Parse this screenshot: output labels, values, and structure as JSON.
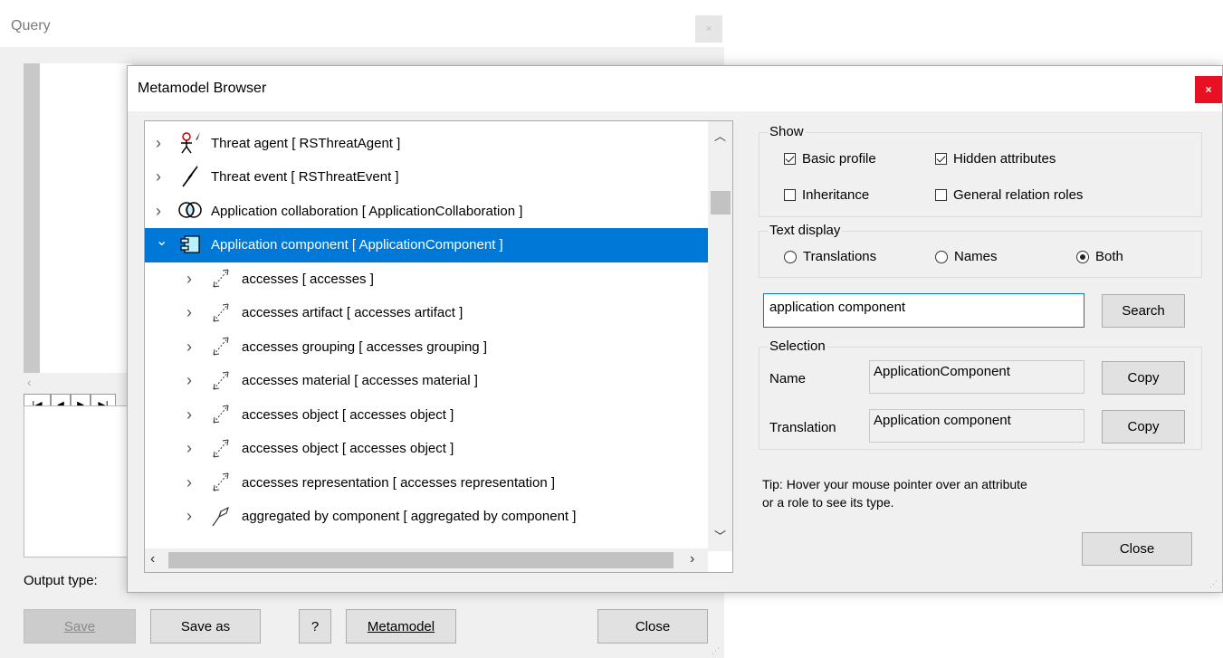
{
  "query_window": {
    "title": "Query",
    "output_type_label": "Output type:",
    "buttons": {
      "save": "Save",
      "save_as": "Save as",
      "help": "?",
      "metamodel": "Metamodel",
      "close": "Close"
    }
  },
  "browser": {
    "title": "Metamodel Browser",
    "close_glyph": "×",
    "tree": [
      {
        "label": "Threat agent [ RSThreatAgent ]",
        "icon": "threat-agent-icon",
        "level": 0,
        "expanded": false,
        "selected": false
      },
      {
        "label": "Threat event [ RSThreatEvent ]",
        "icon": "threat-event-icon",
        "level": 0,
        "expanded": false,
        "selected": false
      },
      {
        "label": "Application collaboration [ ApplicationCollaboration ]",
        "icon": "collaboration-icon",
        "level": 0,
        "expanded": false,
        "selected": false
      },
      {
        "label": "Application component [ ApplicationComponent ]",
        "icon": "component-icon",
        "level": 0,
        "expanded": true,
        "selected": true
      },
      {
        "label": "accesses [ accesses ]",
        "icon": "access-relation-icon",
        "level": 1,
        "expanded": false,
        "selected": false
      },
      {
        "label": "accesses artifact [ accesses artifact ]",
        "icon": "access-relation-icon",
        "level": 1,
        "expanded": false,
        "selected": false
      },
      {
        "label": "accesses grouping [ accesses grouping ]",
        "icon": "access-relation-icon",
        "level": 1,
        "expanded": false,
        "selected": false
      },
      {
        "label": "accesses material [ accesses material ]",
        "icon": "access-relation-icon",
        "level": 1,
        "expanded": false,
        "selected": false
      },
      {
        "label": "accesses object [ accesses object ]",
        "icon": "access-relation-icon",
        "level": 1,
        "expanded": false,
        "selected": false
      },
      {
        "label": "accesses object [ accesses object ]",
        "icon": "access-relation-icon",
        "level": 1,
        "expanded": false,
        "selected": false
      },
      {
        "label": "accesses representation [ accesses representation ]",
        "icon": "access-relation-icon",
        "level": 1,
        "expanded": false,
        "selected": false
      },
      {
        "label": "aggregated by component [ aggregated by component ]",
        "icon": "aggregation-relation-icon",
        "level": 1,
        "expanded": false,
        "selected": false
      }
    ],
    "show": {
      "label": "Show",
      "basic_profile": {
        "label": "Basic profile",
        "checked": true
      },
      "hidden_attributes": {
        "label": "Hidden attributes",
        "checked": true
      },
      "inheritance": {
        "label": "Inheritance",
        "checked": false
      },
      "general_relation_roles": {
        "label": "General relation roles",
        "checked": false
      }
    },
    "text_display": {
      "label": "Text display",
      "options": [
        {
          "label": "Translations",
          "selected": false
        },
        {
          "label": "Names",
          "selected": false
        },
        {
          "label": "Both",
          "selected": true
        }
      ]
    },
    "search": {
      "value": "application component",
      "button": "Search"
    },
    "selection": {
      "label": "Selection",
      "name_label": "Name",
      "name_value": "ApplicationComponent",
      "translation_label": "Translation",
      "translation_value": "Application component",
      "copy": "Copy"
    },
    "tip_line1": "Tip: Hover your mouse pointer over an attribute",
    "tip_line2": "or a role to see its type.",
    "close_button": "Close",
    "colors": {
      "selection": "#0078d7",
      "close_red": "#e81123"
    }
  }
}
